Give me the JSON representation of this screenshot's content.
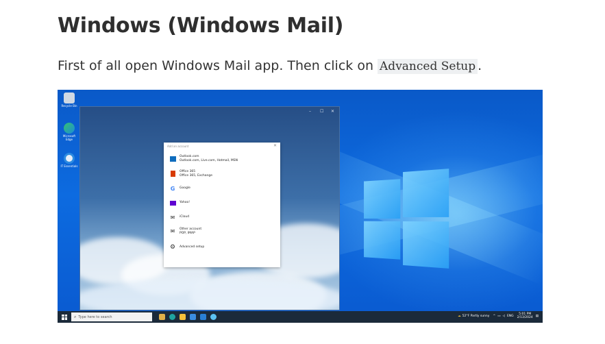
{
  "heading": "Windows (Windows Mail)",
  "intro": {
    "text": "First of all open Windows Mail app. Then click on ",
    "code": "Advanced Setup",
    "suffix": "."
  },
  "screenshot": {
    "desktop_icons": [
      {
        "label": "Recycle Bin",
        "icon": "recycle-bin-icon"
      },
      {
        "label": "Microsoft Edge",
        "icon": "edge-icon"
      },
      {
        "label": "IT Essentials",
        "icon": "app-icon"
      }
    ],
    "mail_window": {
      "controls": [
        "–",
        "☐",
        "✕"
      ]
    },
    "dialog": {
      "title": "Add an account",
      "close": "✕",
      "accounts": [
        {
          "line1": "Outlook.com",
          "line2": "Outlook.com, Live.com, Hotmail, MSN",
          "icon": "outlook-icon",
          "color": "#0f6cbd"
        },
        {
          "line1": "Office 365",
          "line2": "Office 365, Exchange",
          "icon": "office-icon",
          "color": "#d83b01"
        },
        {
          "line1": "Google",
          "line2": "",
          "icon": "google-icon",
          "color": "#4285f4"
        },
        {
          "line1": "Yahoo!",
          "line2": "",
          "icon": "yahoo-icon",
          "color": "#5f01d1"
        },
        {
          "line1": "iCloud",
          "line2": "",
          "icon": "icloud-mail-icon",
          "color": "#333333"
        },
        {
          "line1": "Other account",
          "line2": "POP, IMAP",
          "icon": "mail-icon",
          "color": "#333333"
        },
        {
          "line1": "Advanced setup",
          "line2": "",
          "icon": "gear-icon",
          "color": "#333333"
        }
      ]
    },
    "taskbar": {
      "search_placeholder": "Type here to search",
      "weather": "52°F Partly sunny",
      "lang": "ENG",
      "time": "5:01 PM",
      "date": "2/13/2024"
    },
    "colors": {
      "desktop_blue": "#0d6be0",
      "taskbar": "#1b2a3a"
    }
  }
}
